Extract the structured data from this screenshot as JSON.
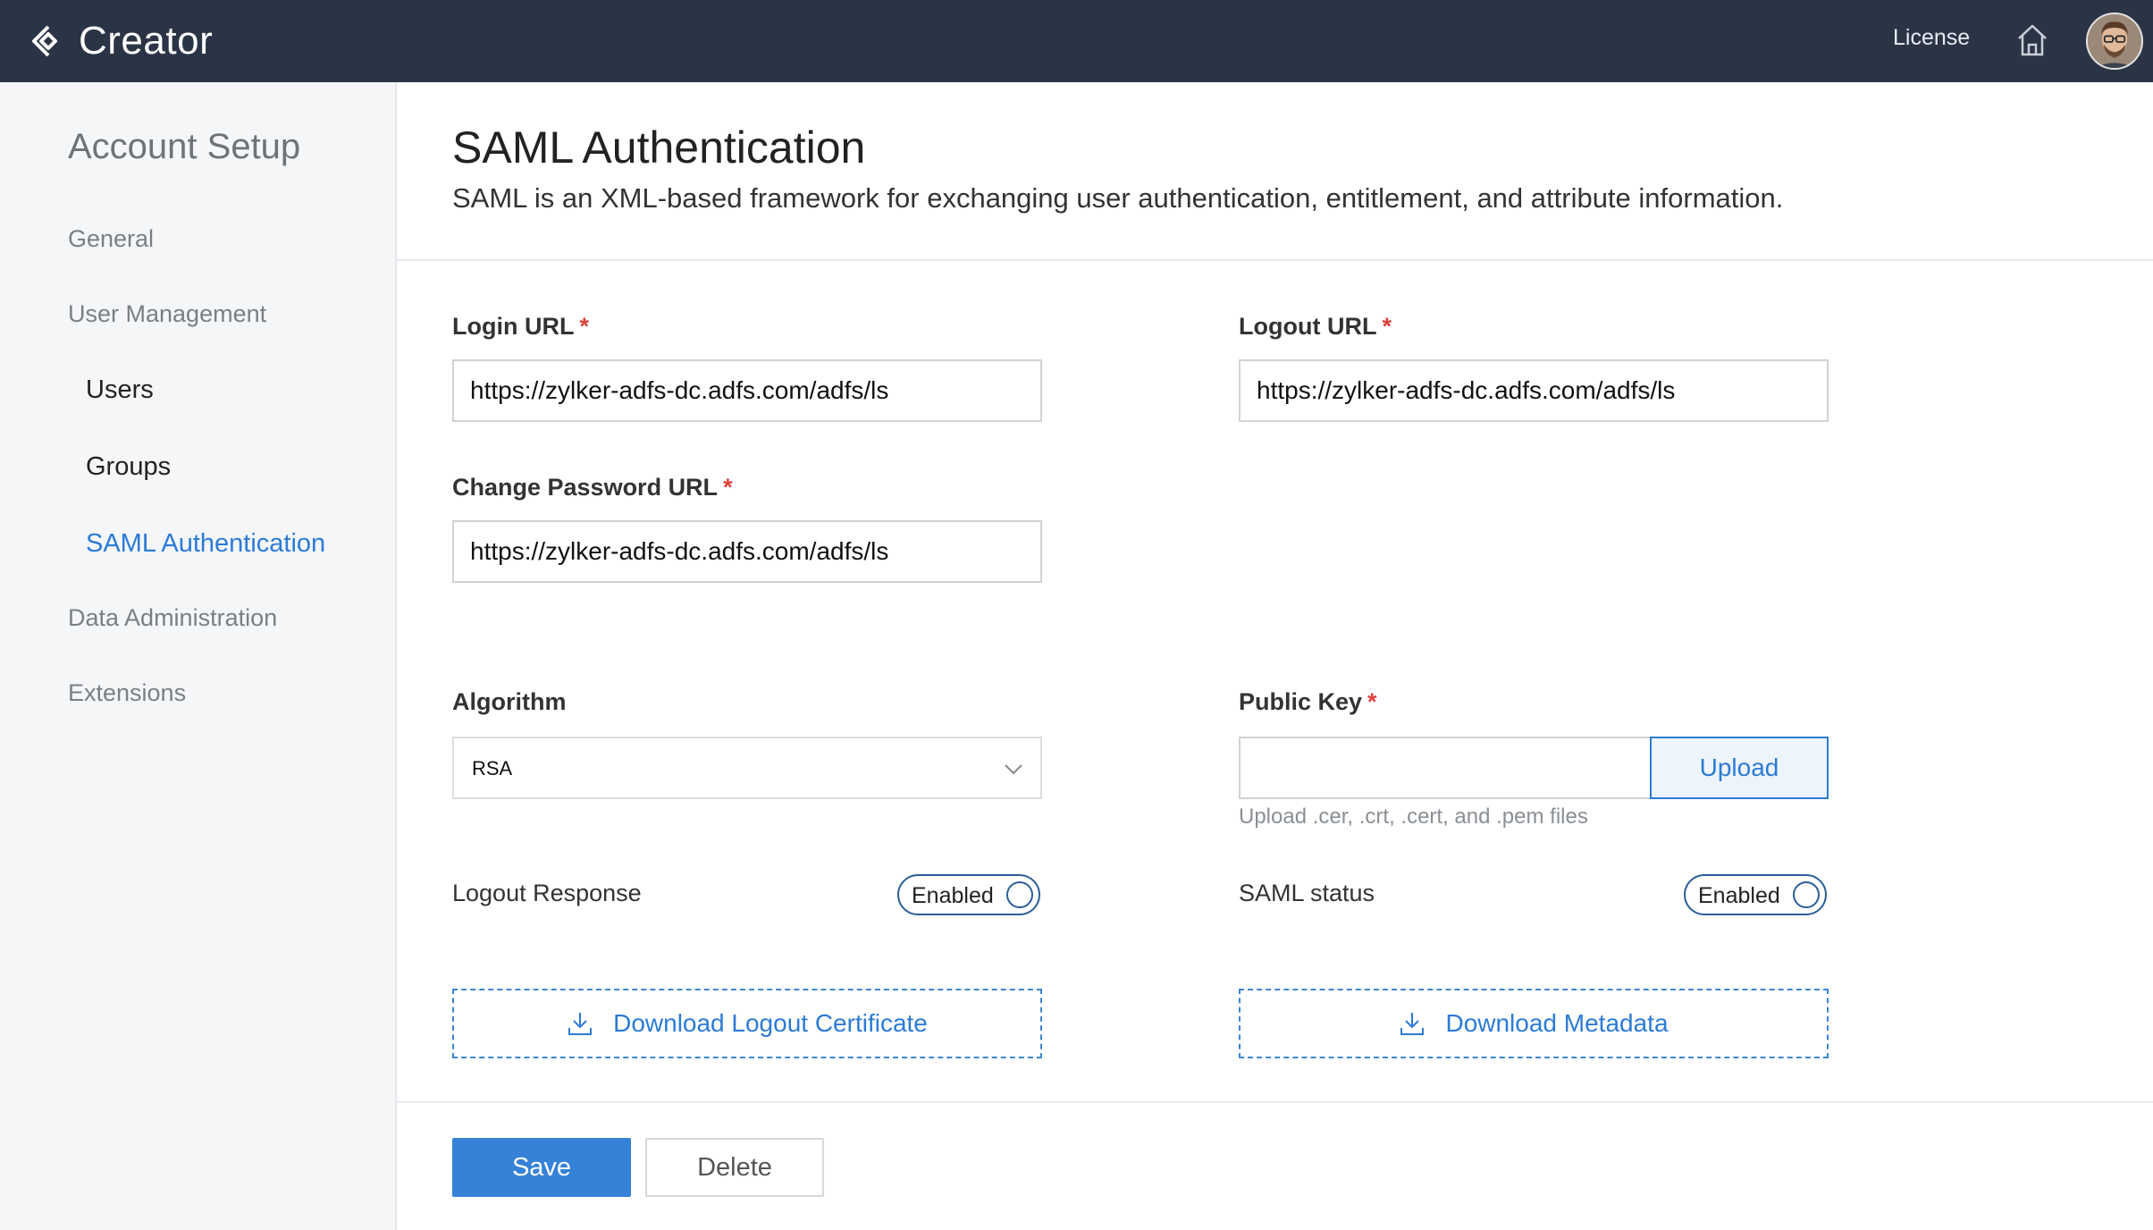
{
  "header": {
    "brand": "Creator",
    "license_label": "License"
  },
  "sidebar": {
    "title": "Account Setup",
    "items": [
      {
        "label": "General"
      },
      {
        "label": "User Management"
      },
      {
        "label": "Users"
      },
      {
        "label": "Groups"
      },
      {
        "label": "SAML Authentication"
      },
      {
        "label": "Data Administration"
      },
      {
        "label": "Extensions"
      }
    ]
  },
  "page": {
    "title": "SAML Authentication",
    "description": "SAML is an XML-based framework for exchanging user authentication, entitlement, and attribute information."
  },
  "form": {
    "login_url": {
      "label": "Login URL",
      "required_mark": "*",
      "value": "https://zylker-adfs-dc.adfs.com/adfs/ls"
    },
    "logout_url": {
      "label": "Logout URL",
      "required_mark": "*",
      "value": "https://zylker-adfs-dc.adfs.com/adfs/ls"
    },
    "change_password_url": {
      "label": "Change Password URL",
      "required_mark": "*",
      "value": "https://zylker-adfs-dc.adfs.com/adfs/ls"
    },
    "algorithm": {
      "label": "Algorithm",
      "selected": "RSA"
    },
    "public_key": {
      "label": "Public Key",
      "required_mark": "*",
      "upload_label": "Upload",
      "hint": "Upload .cer, .crt, .cert, and .pem files"
    },
    "logout_response": {
      "label": "Logout Response",
      "toggle_text": "Enabled"
    },
    "saml_status": {
      "label": "SAML status",
      "toggle_text": "Enabled"
    },
    "download_logout_certificate": "Download Logout Certificate",
    "download_metadata": "Download Metadata"
  },
  "actions": {
    "save_label": "Save",
    "delete_label": "Delete"
  },
  "colors": {
    "topbar": "#2b3445",
    "accent": "#2b7bd6",
    "required": "#e0403a"
  }
}
